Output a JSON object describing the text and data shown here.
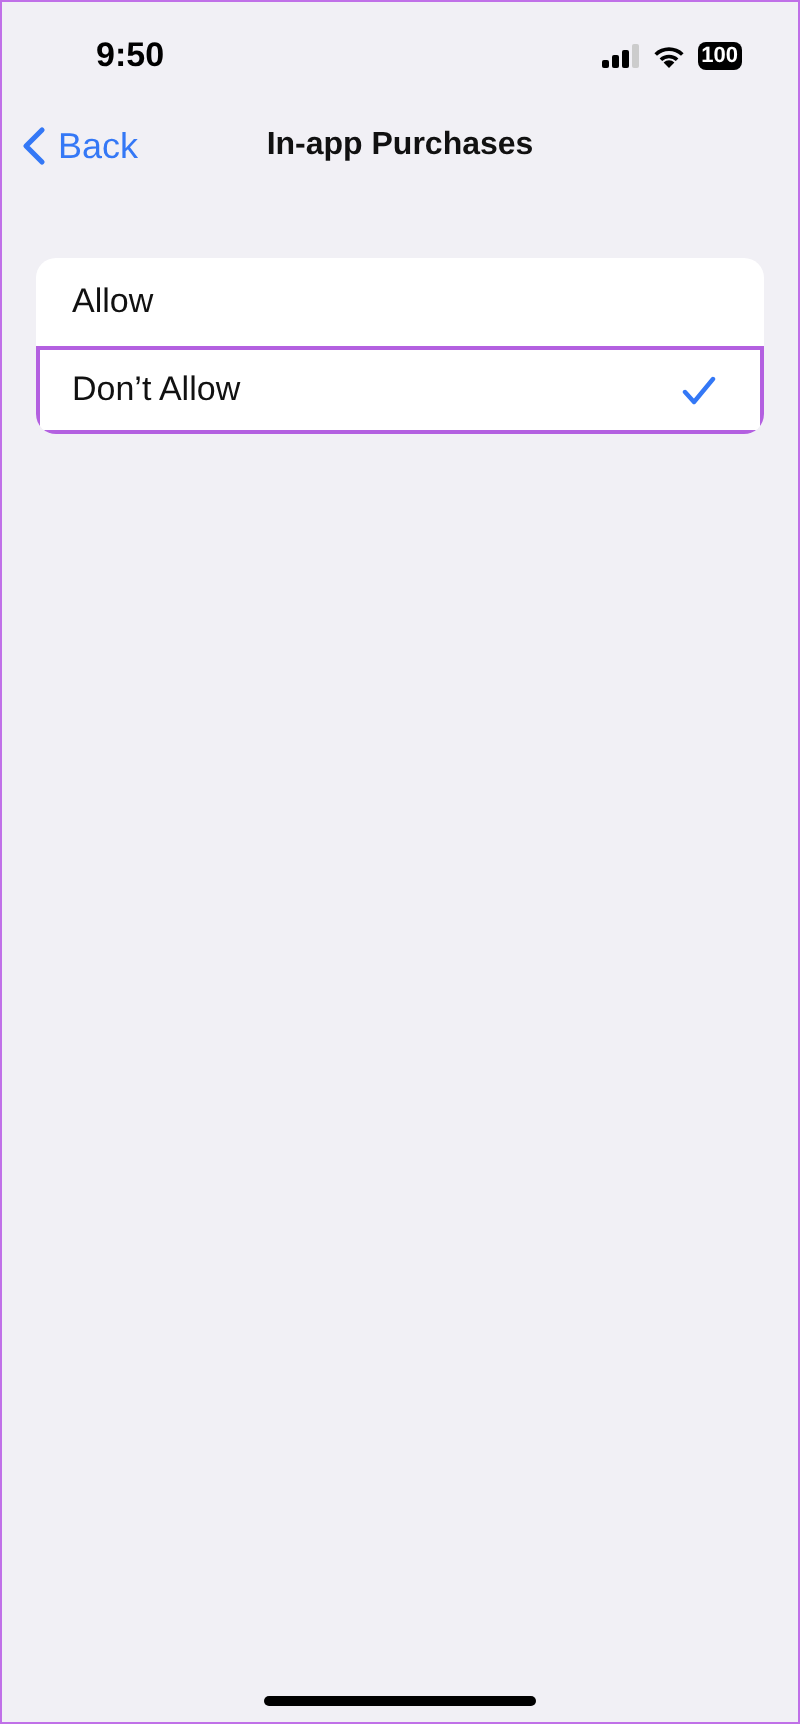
{
  "status_bar": {
    "time": "9:50",
    "battery": "100"
  },
  "nav": {
    "back": "Back",
    "title": "In-app Purchases"
  },
  "options": [
    {
      "label": "Allow",
      "selected": false,
      "highlighted": false
    },
    {
      "label": "Don’t Allow",
      "selected": true,
      "highlighted": true
    }
  ]
}
